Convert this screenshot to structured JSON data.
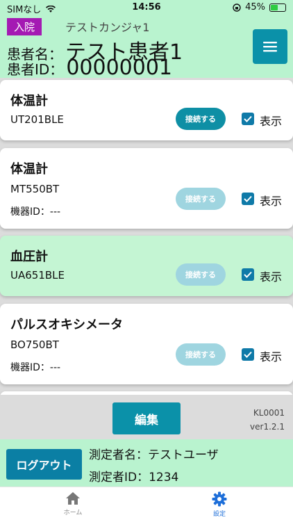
{
  "status": {
    "carrier": "SIMなし",
    "time": "14:56",
    "battery": "45%",
    "battery_level": 0.45
  },
  "header": {
    "admission_badge": "入院",
    "patient_kana": "テストカンジャ1",
    "patient_name_label": "患者名：",
    "patient_name": "テスト患者1",
    "patient_id_label": "患者ID：",
    "patient_id": "00000001"
  },
  "devices": [
    {
      "title": "体温計",
      "model": "UT201BLE",
      "device_id": "",
      "connect_label": "接続する",
      "connect_enabled": true,
      "show_label": "表示",
      "shown": true
    },
    {
      "title": "体温計",
      "model": "MT550BT",
      "device_id": "機器ID：---",
      "connect_label": "接続する",
      "connect_enabled": false,
      "show_label": "表示",
      "shown": true
    },
    {
      "title": "血圧計",
      "model": "UA651BLE",
      "device_id": "",
      "connect_label": "接続する",
      "connect_enabled": false,
      "show_label": "表示",
      "shown": true
    },
    {
      "title": "パルスオキシメータ",
      "model": "BO750BT",
      "device_id": "機器ID：---",
      "connect_label": "接続する",
      "connect_enabled": false,
      "show_label": "表示",
      "shown": true
    }
  ],
  "editbar": {
    "edit_label": "編集",
    "code": "KL0001",
    "version": "ver1.2.1"
  },
  "user": {
    "logout_label": "ログアウト",
    "measurer_name_label": "測定者名：",
    "measurer_name": "テストユーザ",
    "measurer_id_label": "測定者ID：",
    "measurer_id": "1234"
  },
  "tabs": {
    "home": "ホーム",
    "settings": "設定"
  },
  "colors": {
    "accent": "#0b91a9",
    "header_bg": "#b9f3cf",
    "badge": "#a41ab3",
    "active_tab": "#1e6fd9"
  }
}
